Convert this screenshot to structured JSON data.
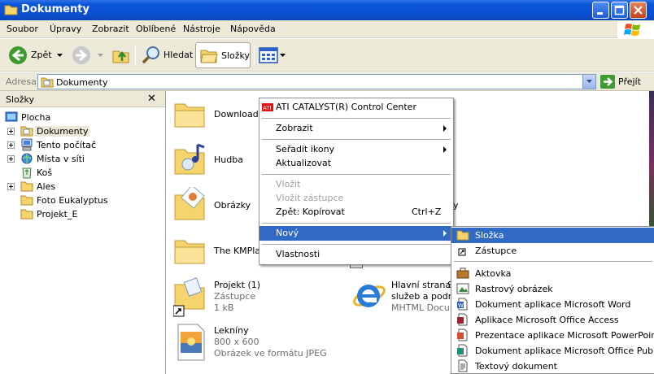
{
  "window": {
    "title": "Dokumenty"
  },
  "menu": [
    "Soubor",
    "Úpravy",
    "Zobrazit",
    "Oblíbené",
    "Nástroje",
    "Nápověda"
  ],
  "toolbar": {
    "back": "Zpět",
    "search": "Hledat",
    "folders": "Složky"
  },
  "address": {
    "label": "Adresa",
    "value": "Dokumenty",
    "go": "Přejít"
  },
  "folders_pane": {
    "title": "Složky",
    "close": "✕",
    "items": [
      "Plocha",
      "Dokumenty",
      "Tento počítač",
      "Místa v síti",
      "Koš",
      "Ales",
      "Foto Eukalyptus",
      "Projekt_E"
    ]
  },
  "files": {
    "downloads": "Downloads",
    "hudba": "Hudba",
    "obrazky": "Obrázky",
    "kmplayer": "The KMPlay",
    "projekt_name": "Projekt (1)",
    "projekt_type": "Zástupce",
    "projekt_size": "1 kB",
    "hlavni_name1": "Hlavní strana",
    "hlavni_name2": "služeb a podnik",
    "hlavni_type": "MHTML Docume",
    "leknin_name": "Lekníny",
    "leknin_dim": "800 x 600",
    "leknin_type": "Obrázek ve formátu JPEG",
    "partial_s": "S",
    "partial_y": "y"
  },
  "context_menu": {
    "ati": "ATI CATALYST(R) Control Center",
    "zobrazit": "Zobrazit",
    "seradit": "Seřadit ikony",
    "aktualizovat": "Aktualizovat",
    "vlozit": "Vložit",
    "vlozit_zastupce": "Vložit zástupce",
    "zpet": "Zpět: Kopírovat",
    "zpet_shortcut": "Ctrl+Z",
    "novy": "Nový",
    "vlastnosti": "Vlastnosti"
  },
  "new_submenu": {
    "slozka": "Složka",
    "zastupce": "Zástupce",
    "aktovka": "Aktovka",
    "rastrovy": "Rastrový obrázek",
    "word": "Dokument aplikace Microsoft Word",
    "access": "Aplikace Microsoft Office Access",
    "powerpoint": "Prezentace aplikace Microsoft PowerPoint",
    "publisher": "Dokument aplikace Microsoft Office Publisher",
    "textovy": "Textový dokument"
  },
  "colors": {
    "highlight": "#316ac5",
    "title_bar": "#0a56d8",
    "chrome": "#ece9d8"
  }
}
